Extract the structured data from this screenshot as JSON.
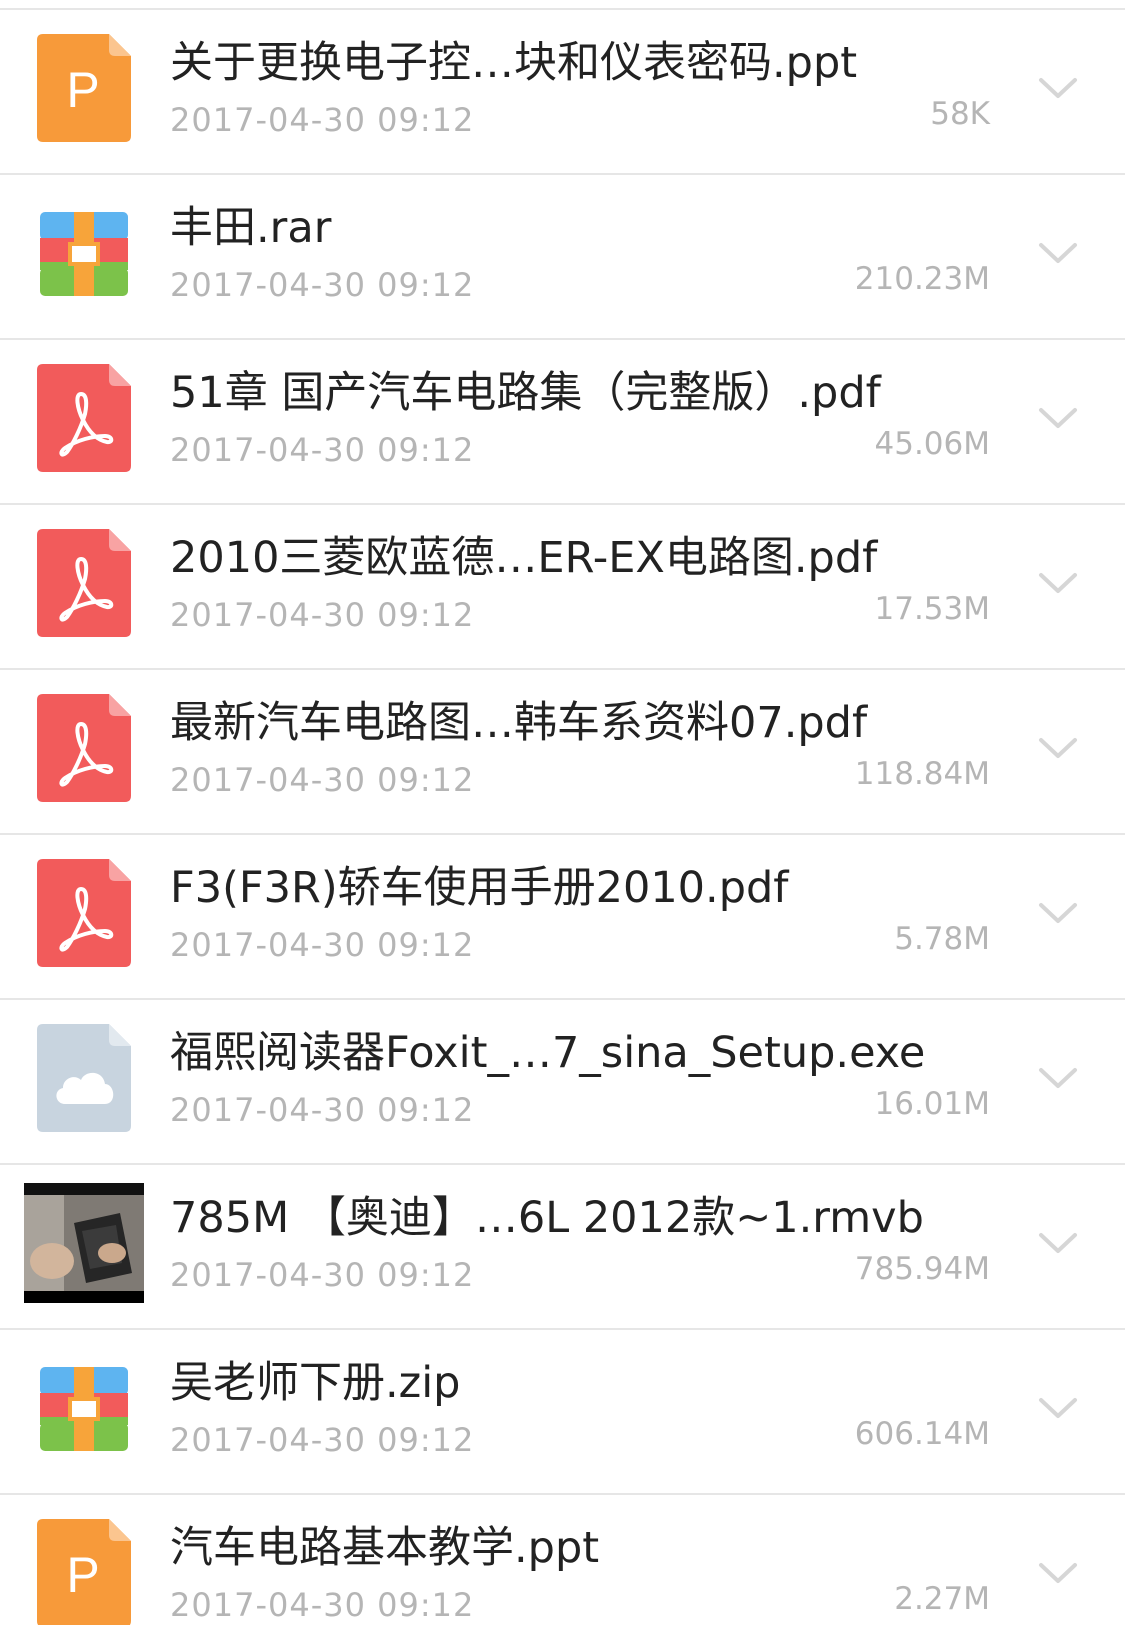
{
  "colors": {
    "ppt": "#f79a3a",
    "pdf": "#f25b5b",
    "cloud": "#c8d4df",
    "rar_blue": "#5eb4f0",
    "rar_red": "#f25b5b",
    "rar_green": "#7cc24a",
    "rar_orange": "#f7a43a",
    "divider": "#e6e6e6",
    "name_text": "#222222",
    "meta_text": "#b5b5b5"
  },
  "files": [
    {
      "icon": "ppt-file-icon",
      "icon_letter": "P",
      "name": "关于更换电子控…块和仪表密码.ppt",
      "date": "2017-04-30 09:12",
      "size": "58K"
    },
    {
      "icon": "archive-file-icon",
      "name": "丰田.rar",
      "date": "2017-04-30 09:12",
      "size": "210.23M"
    },
    {
      "icon": "pdf-file-icon",
      "name": "51章 国产汽车电路集（完整版）.pdf",
      "date": "2017-04-30 09:12",
      "size": "45.06M"
    },
    {
      "icon": "pdf-file-icon",
      "name": "2010三菱欧蓝德…ER-EX电路图.pdf",
      "date": "2017-04-30 09:12",
      "size": "17.53M"
    },
    {
      "icon": "pdf-file-icon",
      "name": "最新汽车电路图…韩车系资料07.pdf",
      "date": "2017-04-30 09:12",
      "size": "118.84M"
    },
    {
      "icon": "pdf-file-icon",
      "name": "F3(F3R)轿车使用手册2010.pdf",
      "date": "2017-04-30 09:12",
      "size": "5.78M"
    },
    {
      "icon": "cloud-file-icon",
      "name": "福熙阅读器Foxit_…7_sina_Setup.exe",
      "date": "2017-04-30 09:12",
      "size": "16.01M"
    },
    {
      "icon": "video-thumbnail",
      "name": "785M 【奥迪】…6L 2012款~1.rmvb",
      "date": "2017-04-30 09:12",
      "size": "785.94M"
    },
    {
      "icon": "archive-file-icon",
      "name": "吴老师下册.zip",
      "date": "2017-04-30 09:12",
      "size": "606.14M"
    },
    {
      "icon": "ppt-file-icon",
      "icon_letter": "P",
      "name": "汽车电路基本教学.ppt",
      "date": "2017-04-30 09:12",
      "size": "2.27M"
    }
  ]
}
